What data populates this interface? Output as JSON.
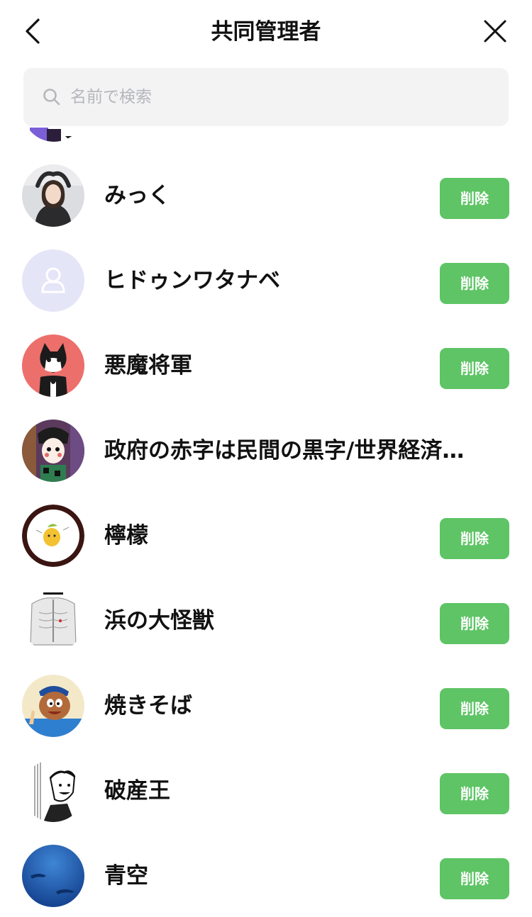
{
  "header": {
    "title": "共同管理者",
    "back_icon": "chevron-left-icon",
    "close_icon": "close-icon"
  },
  "search": {
    "placeholder": "名前で検索",
    "icon": "search-icon"
  },
  "colors": {
    "accent_green": "#5ec465",
    "search_bg": "#f3f3f4",
    "placeholder_text": "#b5b7bb"
  },
  "members": [
    {
      "name": "みっく",
      "delete_label": "削除",
      "avatar": "photo-avatar"
    },
    {
      "name": "ヒドゥンワタナベ",
      "delete_label": "削除",
      "avatar": "default-person-avatar"
    },
    {
      "name": "悪魔将軍",
      "delete_label": "削除",
      "avatar": "cat-avatar"
    },
    {
      "name": "政府の赤字は民間の黒字/世界経済…",
      "delete_label": "",
      "avatar": "illustration-avatar"
    },
    {
      "name": "檸檬",
      "delete_label": "削除",
      "avatar": "lemon-avatar"
    },
    {
      "name": "浜の大怪獣",
      "delete_label": "削除",
      "avatar": "anatomy-avatar"
    },
    {
      "name": "焼きそば",
      "delete_label": "削除",
      "avatar": "cartoon-avatar"
    },
    {
      "name": "破産王",
      "delete_label": "削除",
      "avatar": "manga-avatar"
    },
    {
      "name": "青空",
      "delete_label": "削除",
      "avatar": "ocean-avatar"
    }
  ]
}
